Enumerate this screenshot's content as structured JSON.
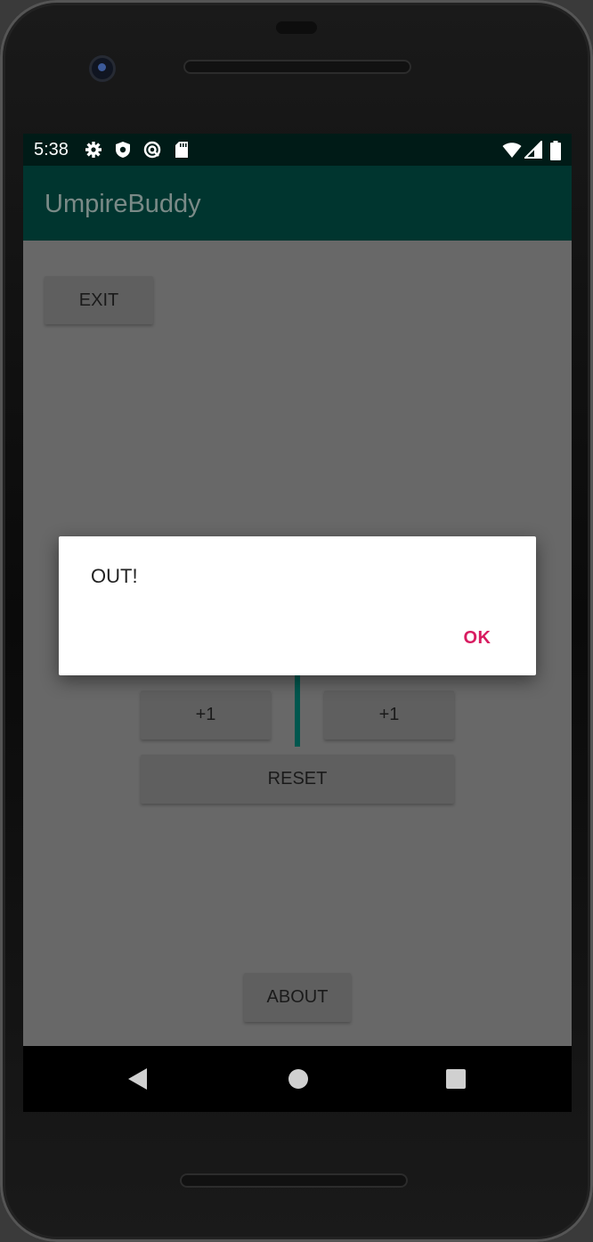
{
  "status_bar": {
    "time": "5:38",
    "left_icons": [
      "gear-icon",
      "shield-icon",
      "at-sign-icon",
      "sd-card-icon"
    ],
    "right_icons": [
      "wifi-icon",
      "signal-icon",
      "battery-icon"
    ]
  },
  "app_bar": {
    "title": "UmpireBuddy"
  },
  "buttons": {
    "exit": "EXIT",
    "strike_plus": "+1",
    "ball_plus": "+1",
    "reset": "RESET",
    "about": "ABOUT"
  },
  "dialog": {
    "message": "OUT!",
    "ok": "OK"
  },
  "colors": {
    "status_bar": "#001b17",
    "app_bar": "#00352f",
    "accent": "#d81b60",
    "divider": "#00574e"
  }
}
